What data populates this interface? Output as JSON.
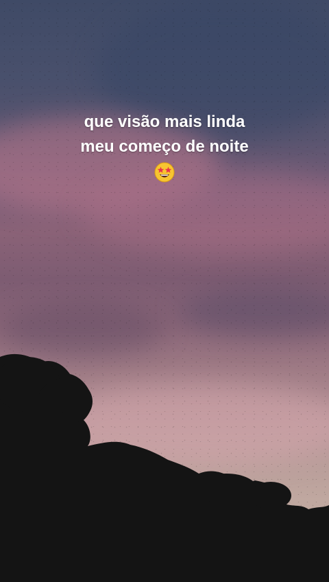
{
  "caption": {
    "line1": "que visão mais linda",
    "line2": "meu começo de noite",
    "emoji": "star-struck-emoji"
  },
  "colors": {
    "sky_top": "#3f4a66",
    "sky_pink": "#8a6277",
    "sky_horizon": "#c8b0a4",
    "tree_silhouette": "#141414",
    "caption_text": "#ffffff"
  }
}
